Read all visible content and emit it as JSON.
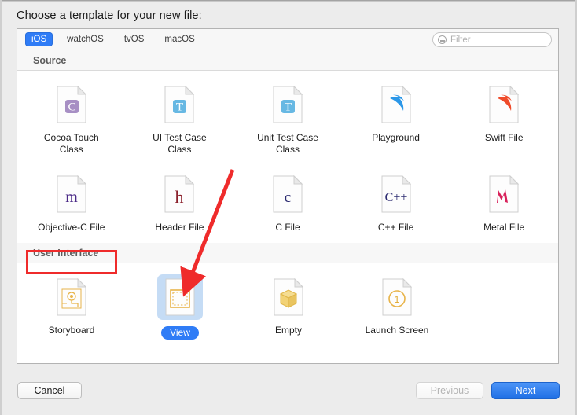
{
  "dialog": {
    "title": "Choose a template for your new file:"
  },
  "tabs": [
    {
      "label": "iOS",
      "active": true
    },
    {
      "label": "watchOS",
      "active": false
    },
    {
      "label": "tvOS",
      "active": false
    },
    {
      "label": "macOS",
      "active": false
    }
  ],
  "filter": {
    "placeholder": "Filter",
    "value": "",
    "icon": "filter-list-icon"
  },
  "sections": [
    {
      "header": "Source",
      "rows": [
        [
          {
            "label": "Cocoa Touch\nClass",
            "icon": "cocoa-touch-class-icon",
            "selected": false
          },
          {
            "label": "UI Test Case\nClass",
            "icon": "ui-test-case-class-icon",
            "selected": false
          },
          {
            "label": "Unit Test Case\nClass",
            "icon": "unit-test-case-class-icon",
            "selected": false
          },
          {
            "label": "Playground",
            "icon": "playground-icon",
            "selected": false
          },
          {
            "label": "Swift File",
            "icon": "swift-file-icon",
            "selected": false
          }
        ],
        [
          {
            "label": "Objective-C File",
            "icon": "objective-c-file-icon",
            "selected": false
          },
          {
            "label": "Header File",
            "icon": "header-file-icon",
            "selected": false
          },
          {
            "label": "C File",
            "icon": "c-file-icon",
            "selected": false
          },
          {
            "label": "C++ File",
            "icon": "cpp-file-icon",
            "selected": false
          },
          {
            "label": "Metal File",
            "icon": "metal-file-icon",
            "selected": false
          }
        ]
      ]
    },
    {
      "header": "User Interface",
      "rows": [
        [
          {
            "label": "Storyboard",
            "icon": "storyboard-icon",
            "selected": false
          },
          {
            "label": "View",
            "icon": "view-icon",
            "selected": true
          },
          {
            "label": "Empty",
            "icon": "empty-icon",
            "selected": false
          },
          {
            "label": "Launch Screen",
            "icon": "launch-screen-icon",
            "selected": false
          }
        ]
      ]
    }
  ],
  "buttons": {
    "cancel": "Cancel",
    "previous": "Previous",
    "next": "Next"
  },
  "annotations": {
    "highlight_box_target": "User Interface",
    "arrow_points_to": "View",
    "color": "#ef2b2b"
  },
  "colors": {
    "accent": "#2f7cf6",
    "selection_fill": "#c5dcf5",
    "annotation": "#ef2b2b",
    "panel_bg": "#ffffff",
    "window_bg": "#ececec"
  }
}
